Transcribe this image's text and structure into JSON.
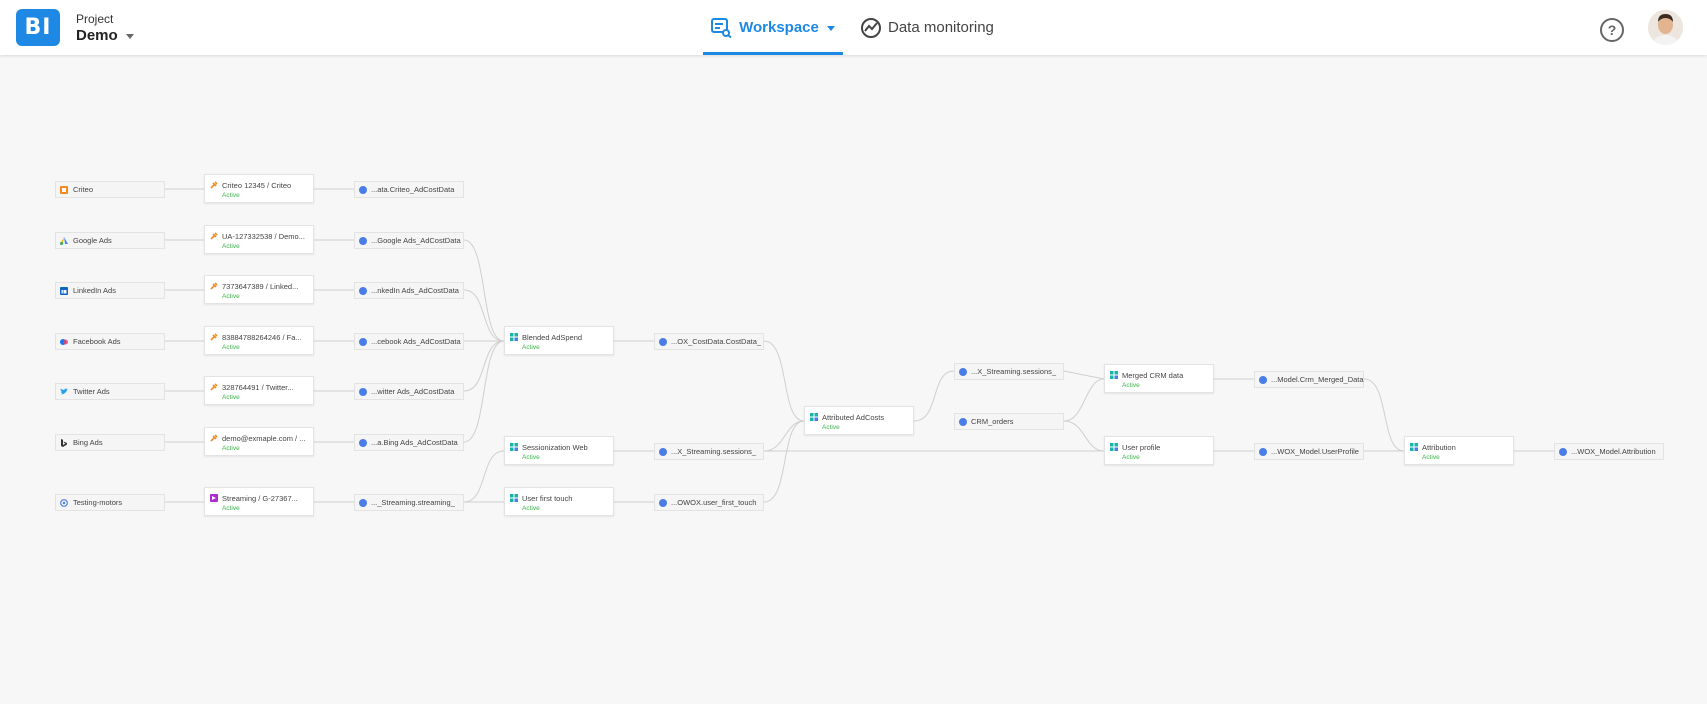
{
  "header": {
    "logo_text": "BI",
    "project_label": "Project",
    "project_name": "Demo",
    "tabs": [
      {
        "label": "Workspace",
        "active": true
      },
      {
        "label": "Data monitoring",
        "active": false
      }
    ],
    "help_symbol": "?"
  },
  "colors": {
    "accent": "#1e88e5",
    "active_status": "#3bb54a",
    "table_dot": "#4a7de5",
    "blend_icon": "#1bb3a9",
    "connector_icon": "#f58a1f"
  },
  "sources": [
    {
      "label": "Criteo",
      "icon": "criteo-icon"
    },
    {
      "label": "Google Ads",
      "icon": "google-ads-icon"
    },
    {
      "label": "LinkedIn Ads",
      "icon": "linkedin-icon"
    },
    {
      "label": "Facebook Ads",
      "icon": "facebook-icon"
    },
    {
      "label": "Twitter Ads",
      "icon": "twitter-icon"
    },
    {
      "label": "Bing Ads",
      "icon": "bing-icon"
    },
    {
      "label": "Testing-motors",
      "icon": "testing-motors-icon"
    }
  ],
  "connectors": [
    {
      "label": "Criteo 12345 / Criteo",
      "status": "Active"
    },
    {
      "label": "UA-127332538 / Demo...",
      "status": "Active"
    },
    {
      "label": "7373647389 / Linked...",
      "status": "Active"
    },
    {
      "label": "83884788264246 / Fa...",
      "status": "Active"
    },
    {
      "label": "328764491 / Twitter...",
      "status": "Active"
    },
    {
      "label": "demo@exmaple.com / ...",
      "status": "Active"
    },
    {
      "label": "Streaming / G-27367...",
      "status": "Active"
    }
  ],
  "tables_l1": [
    "...ata.Criteo_AdCostData",
    "...Google Ads_AdCostData",
    "...nkedIn Ads_AdCostData",
    "...cebook Ads_AdCostData",
    "...witter Ads_AdCostData",
    "...a.Bing Ads_AdCostData",
    "..._Streaming.streaming_"
  ],
  "transforms": {
    "blended": {
      "label": "Blended AdSpend",
      "status": "Active"
    },
    "sessionization": {
      "label": "Sessionization Web",
      "status": "Active"
    },
    "user_first_touch": {
      "label": "User first touch",
      "status": "Active"
    },
    "attributed": {
      "label": "Attributed AdCosts",
      "status": "Active"
    },
    "merged_crm": {
      "label": "Merged CRM data",
      "status": "Active"
    },
    "user_profile": {
      "label": "User profile",
      "status": "Active"
    },
    "attribution": {
      "label": "Attribution",
      "status": "Active"
    }
  },
  "tables_l2": {
    "cost": "...OX_CostData.CostData_",
    "sessions": "...X_Streaming.sessions_",
    "first_touch": "...OWOX.user_first_touch",
    "sessions2": "...X_Streaming.sessions_",
    "crm_orders": "CRM_orders",
    "crm_merged": "...Model.Crm_Merged_Data",
    "user_profile": "...WOX_Model.UserProfile",
    "attribution": "...WOX_Model.Attribution"
  }
}
